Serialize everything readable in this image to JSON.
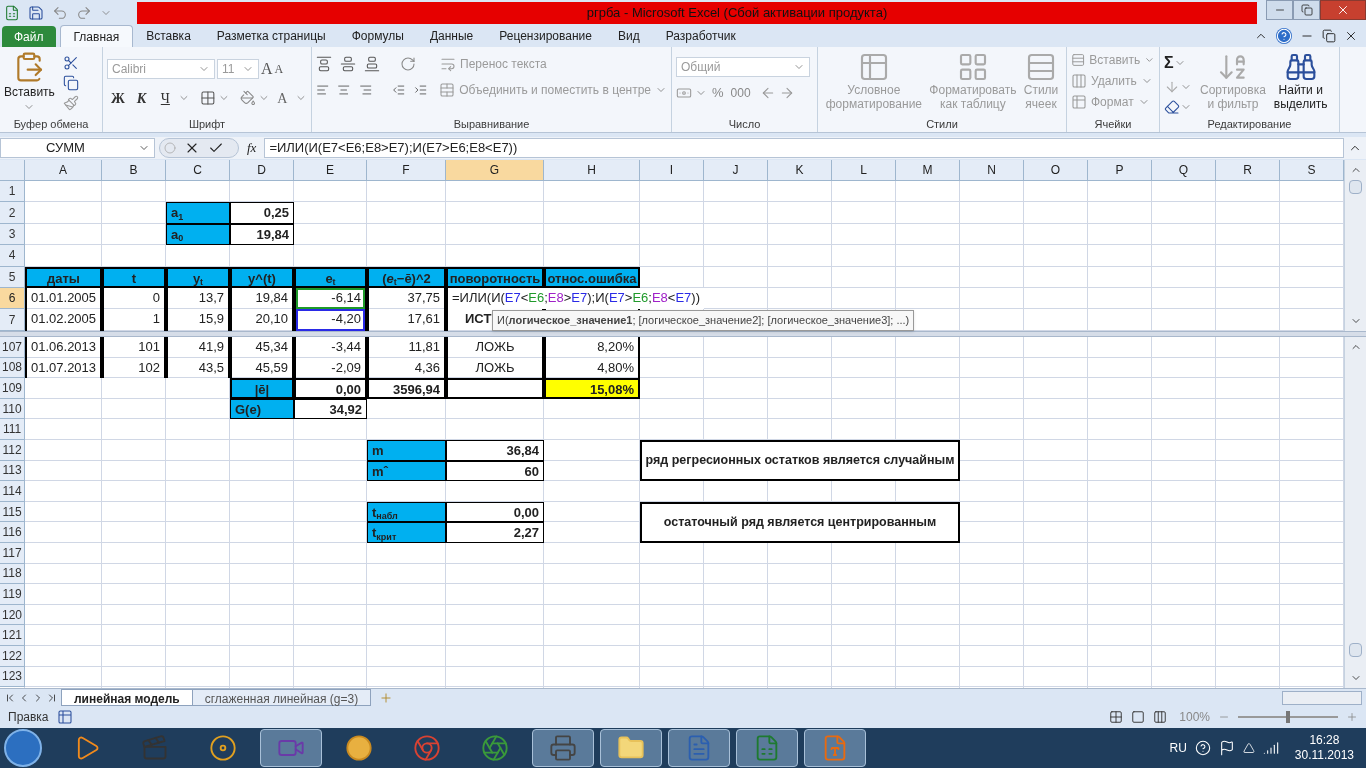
{
  "title_bar": {
    "title": "ргрба  -  Microsoft Excel (Сбой активации продукта)"
  },
  "tabs": [
    {
      "label": "Файл",
      "kind": "file",
      "selected": false
    },
    {
      "label": "Главная",
      "kind": "tab",
      "selected": true
    },
    {
      "label": "Вставка",
      "kind": "tab",
      "selected": false
    },
    {
      "label": "Разметка страницы",
      "kind": "tab",
      "selected": false
    },
    {
      "label": "Формулы",
      "kind": "tab",
      "selected": false
    },
    {
      "label": "Данные",
      "kind": "tab",
      "selected": false
    },
    {
      "label": "Рецензирование",
      "kind": "tab",
      "selected": false
    },
    {
      "label": "Вид",
      "kind": "tab",
      "selected": false
    },
    {
      "label": "Разработчик",
      "kind": "tab",
      "selected": false
    }
  ],
  "ribbon": {
    "clipboard": {
      "label": "Буфер обмена",
      "paste": {
        "label": "Вставить",
        "disabled": false
      }
    },
    "font": {
      "label": "Шрифт",
      "font_name": {
        "value": "Calibri",
        "disabled": true
      },
      "font_size": {
        "value": "11",
        "disabled": true
      },
      "grow": "A",
      "shrink": "A",
      "bold": "Ж",
      "italic": "К",
      "underline": "Ч",
      "font_color": "A"
    },
    "alignment": {
      "label": "Выравнивание",
      "wrap": {
        "label": "Перенос текста",
        "disabled": true
      },
      "merge": {
        "label": "Объединить и поместить в центре",
        "disabled": true
      }
    },
    "number": {
      "label": "Число",
      "format": {
        "value": "Общий",
        "disabled": true
      },
      "percent": "%",
      "thousands": "000"
    },
    "styles": {
      "label": "Стили",
      "buttons": [
        {
          "label": "Условное\nформатирование",
          "disabled": true
        },
        {
          "label": "Форматировать\nкак таблицу",
          "disabled": true
        },
        {
          "label": "Стили\nячеек",
          "disabled": true
        }
      ]
    },
    "cells": {
      "label": "Ячейки",
      "buttons": [
        {
          "label": "Вставить",
          "disabled": true
        },
        {
          "label": "Удалить",
          "disabled": true
        },
        {
          "label": "Формат",
          "disabled": true
        }
      ]
    },
    "editing": {
      "label": "Редактирование",
      "sum": "Σ",
      "buttons": [
        {
          "label": "Сортировка\nи фильтр",
          "disabled": true
        },
        {
          "label": "Найти и\nвыделить",
          "disabled": false
        }
      ]
    }
  },
  "formula_bar": {
    "name_box": "СУММ",
    "function_label": "fx",
    "formula": "=ИЛИ(И(E7<E6;E8>E7);И(E7>E6;E8<E7))"
  },
  "sheet": {
    "columns": [
      {
        "label": "A",
        "selected": false
      },
      {
        "label": "B",
        "selected": false
      },
      {
        "label": "C",
        "selected": false
      },
      {
        "label": "D",
        "selected": false
      },
      {
        "label": "E",
        "selected": false
      },
      {
        "label": "F",
        "selected": false
      },
      {
        "label": "G",
        "selected": true
      },
      {
        "label": "H",
        "selected": false
      },
      {
        "label": "I",
        "selected": false
      },
      {
        "label": "J",
        "selected": false
      },
      {
        "label": "K",
        "selected": false
      },
      {
        "label": "L",
        "selected": false
      },
      {
        "label": "M",
        "selected": false
      },
      {
        "label": "N",
        "selected": false
      },
      {
        "label": "O",
        "selected": false
      },
      {
        "label": "P",
        "selected": false
      },
      {
        "label": "Q",
        "selected": false
      },
      {
        "label": "R",
        "selected": false
      },
      {
        "label": "S",
        "selected": false
      }
    ],
    "top_rows": [
      {
        "number": "1",
        "selected": false,
        "cells": []
      },
      {
        "number": "2",
        "selected": false,
        "cells": [
          {},
          {},
          {
            "kind": "label",
            "text": "a$_{1}$"
          },
          {
            "kind": "value",
            "text": "0,25"
          }
        ]
      },
      {
        "number": "3",
        "selected": false,
        "cells": [
          {},
          {},
          {
            "kind": "label",
            "text": "a$_{0}$"
          },
          {
            "kind": "value",
            "text": "19,84"
          }
        ]
      },
      {
        "number": "4",
        "selected": false,
        "cells": []
      },
      {
        "number": "5",
        "selected": false,
        "cells": [
          {
            "kind": "header",
            "text": "даты"
          },
          {
            "kind": "header",
            "text": "t"
          },
          {
            "kind": "header",
            "text": "y$_{t}$"
          },
          {
            "kind": "header",
            "text": "y^(t)"
          },
          {
            "kind": "header",
            "text": "e$_{t}$"
          },
          {
            "kind": "header",
            "text": "(*e*$_{t}$−ē)^2"
          },
          {
            "kind": "header",
            "text": "поворотность"
          },
          {
            "kind": "header",
            "text": "относ.ошибка"
          }
        ]
      },
      {
        "number": "6",
        "selected": true,
        "cells": [
          {
            "kind": "number",
            "text": "01.01.2005"
          },
          {
            "kind": "number",
            "text": "0"
          },
          {
            "kind": "number",
            "text": "13,7"
          },
          {
            "kind": "number",
            "text": "19,84"
          },
          {
            "kind": "number",
            "text": "-6,14",
            "color": "#1f9a2a"
          },
          {
            "kind": "number",
            "text": "37,75"
          },
          {
            "kind": "formula",
            "segments": [
              {
                "text": "=ИЛИ(И("
              },
              {
                "text": "E7",
                "color": "#2a2ae6"
              },
              {
                "text": "<"
              },
              {
                "text": "E6",
                "color": "#1f9a2a"
              },
              {
                "text": ";"
              },
              {
                "text": "E8",
                "color": "#a020c8"
              },
              {
                "text": ">"
              },
              {
                "text": "E7",
                "color": "#2a2ae6"
              },
              {
                "text": ");И("
              },
              {
                "text": "E7",
                "color": "#2a2ae6"
              },
              {
                "text": ">"
              },
              {
                "text": "E6",
                "color": "#1f9a2a"
              },
              {
                "text": ";"
              },
              {
                "text": "E8",
                "color": "#a020c8"
              },
              {
                "text": "<"
              },
              {
                "text": "E7",
                "color": "#2a2ae6"
              },
              {
                "text": "))"
              }
            ]
          }
        ]
      },
      {
        "number": "7",
        "selected": false,
        "cells": [
          {
            "kind": "number",
            "text": "01.02.2005"
          },
          {
            "kind": "number",
            "text": "1"
          },
          {
            "kind": "number",
            "text": "15,9"
          },
          {
            "kind": "number",
            "text": "20,10"
          },
          {
            "kind": "number",
            "text": "-4,20",
            "color": "#2a2ae6"
          },
          {
            "kind": "number",
            "text": "17,61"
          },
          {
            "kind": "bold_text",
            "text": "ИСТ"
          },
          {
            "kind": "number"
          }
        ]
      }
    ],
    "tooltip": "И(**логическое_значение1**; [логическое_значение2]; [логическое_значение3]; ...)",
    "bottom_rows": [
      {
        "number": "107",
        "selected": false,
        "cells": [
          {
            "kind": "number",
            "text": "01.06.2013"
          },
          {
            "kind": "number",
            "text": "101"
          },
          {
            "kind": "number",
            "text": "41,9"
          },
          {
            "kind": "number",
            "text": "45,34"
          },
          {
            "kind": "number",
            "text": "-3,44"
          },
          {
            "kind": "number",
            "text": "11,81"
          },
          {
            "kind": "text",
            "text": "ЛОЖЬ"
          },
          {
            "kind": "number",
            "text": "8,20%"
          }
        ]
      },
      {
        "number": "108",
        "selected": false,
        "cells": [
          {
            "kind": "number",
            "text": "01.07.2013"
          },
          {
            "kind": "number",
            "text": "102"
          },
          {
            "kind": "number",
            "text": "43,5"
          },
          {
            "kind": "number",
            "text": "45,59"
          },
          {
            "kind": "number",
            "text": "-2,09"
          },
          {
            "kind": "number",
            "text": "4,36"
          },
          {
            "kind": "text",
            "text": "ЛОЖЬ"
          },
          {
            "kind": "number",
            "text": "4,80%"
          }
        ]
      },
      {
        "number": "109",
        "selected": false,
        "cells": [
          {},
          {},
          {},
          {
            "kind": "header",
            "text": "|ē|"
          },
          {
            "kind": "total",
            "text": "0,00"
          },
          {
            "kind": "total",
            "text": "3596,94"
          },
          {
            "kind": "total"
          },
          {
            "kind": "highlight",
            "text": "15,08%"
          }
        ]
      },
      {
        "number": "110",
        "selected": false,
        "cells": [
          {},
          {},
          {},
          {
            "kind": "label",
            "text": "G(e)"
          },
          {
            "kind": "value",
            "text": "34,92"
          }
        ]
      },
      {
        "number": "111",
        "selected": false,
        "cells": []
      },
      {
        "number": "112",
        "selected": false,
        "cells": [
          {},
          {},
          {},
          {},
          {},
          {
            "kind": "label",
            "text": "m"
          },
          {
            "kind": "value",
            "text": "36,84"
          }
        ],
        "note": "ряд регресионных остатков является случайным"
      },
      {
        "number": "113",
        "selected": false,
        "cells": [
          {},
          {},
          {},
          {},
          {},
          {
            "kind": "label",
            "text": "mˆ"
          },
          {
            "kind": "value",
            "text": "60"
          }
        ]
      },
      {
        "number": "114",
        "selected": false,
        "cells": []
      },
      {
        "number": "115",
        "selected": false,
        "cells": [
          {},
          {},
          {},
          {},
          {},
          {
            "kind": "label",
            "text": "t$_{набл}$"
          },
          {
            "kind": "value",
            "text": "0,00"
          }
        ],
        "note": "остаточный ряд является центрированным"
      },
      {
        "number": "116",
        "selected": false,
        "cells": [
          {},
          {},
          {},
          {},
          {},
          {
            "kind": "label",
            "text": "t$_{крит}$"
          },
          {
            "kind": "value",
            "text": "2,27"
          }
        ]
      },
      {
        "number": "117",
        "selected": false,
        "cells": []
      },
      {
        "number": "118",
        "selected": false,
        "cells": []
      },
      {
        "number": "119",
        "selected": false,
        "cells": []
      },
      {
        "number": "120",
        "selected": false,
        "cells": []
      },
      {
        "number": "121",
        "selected": false,
        "cells": []
      },
      {
        "number": "122",
        "selected": false,
        "cells": []
      },
      {
        "number": "123",
        "selected": false,
        "cells": []
      }
    ]
  },
  "sheet_tabs": [
    {
      "label": "линейная модель",
      "selected": true
    },
    {
      "label": "сглаженная линейная (g=3)",
      "selected": false
    }
  ],
  "status_bar": {
    "mode": "Правка",
    "zoom": "100%",
    "zoom_slider": {
      "level": 0.5
    }
  },
  "taskbar": {
    "apps": [
      {
        "kind": "player",
        "running": false
      },
      {
        "kind": "clapper",
        "running": false
      },
      {
        "kind": "disc",
        "running": false
      },
      {
        "kind": "video",
        "running": true
      },
      {
        "kind": "ball",
        "running": false
      },
      {
        "kind": "browser",
        "running": false
      },
      {
        "kind": "pinwheel",
        "running": false
      },
      {
        "kind": "scanner",
        "running": true
      },
      {
        "kind": "folder",
        "running": true
      },
      {
        "kind": "word",
        "running": true
      },
      {
        "kind": "excel",
        "running": true
      },
      {
        "kind": "pdf",
        "running": true
      }
    ],
    "language": "RU",
    "time": "16:28",
    "date": "30.11.2013"
  }
}
